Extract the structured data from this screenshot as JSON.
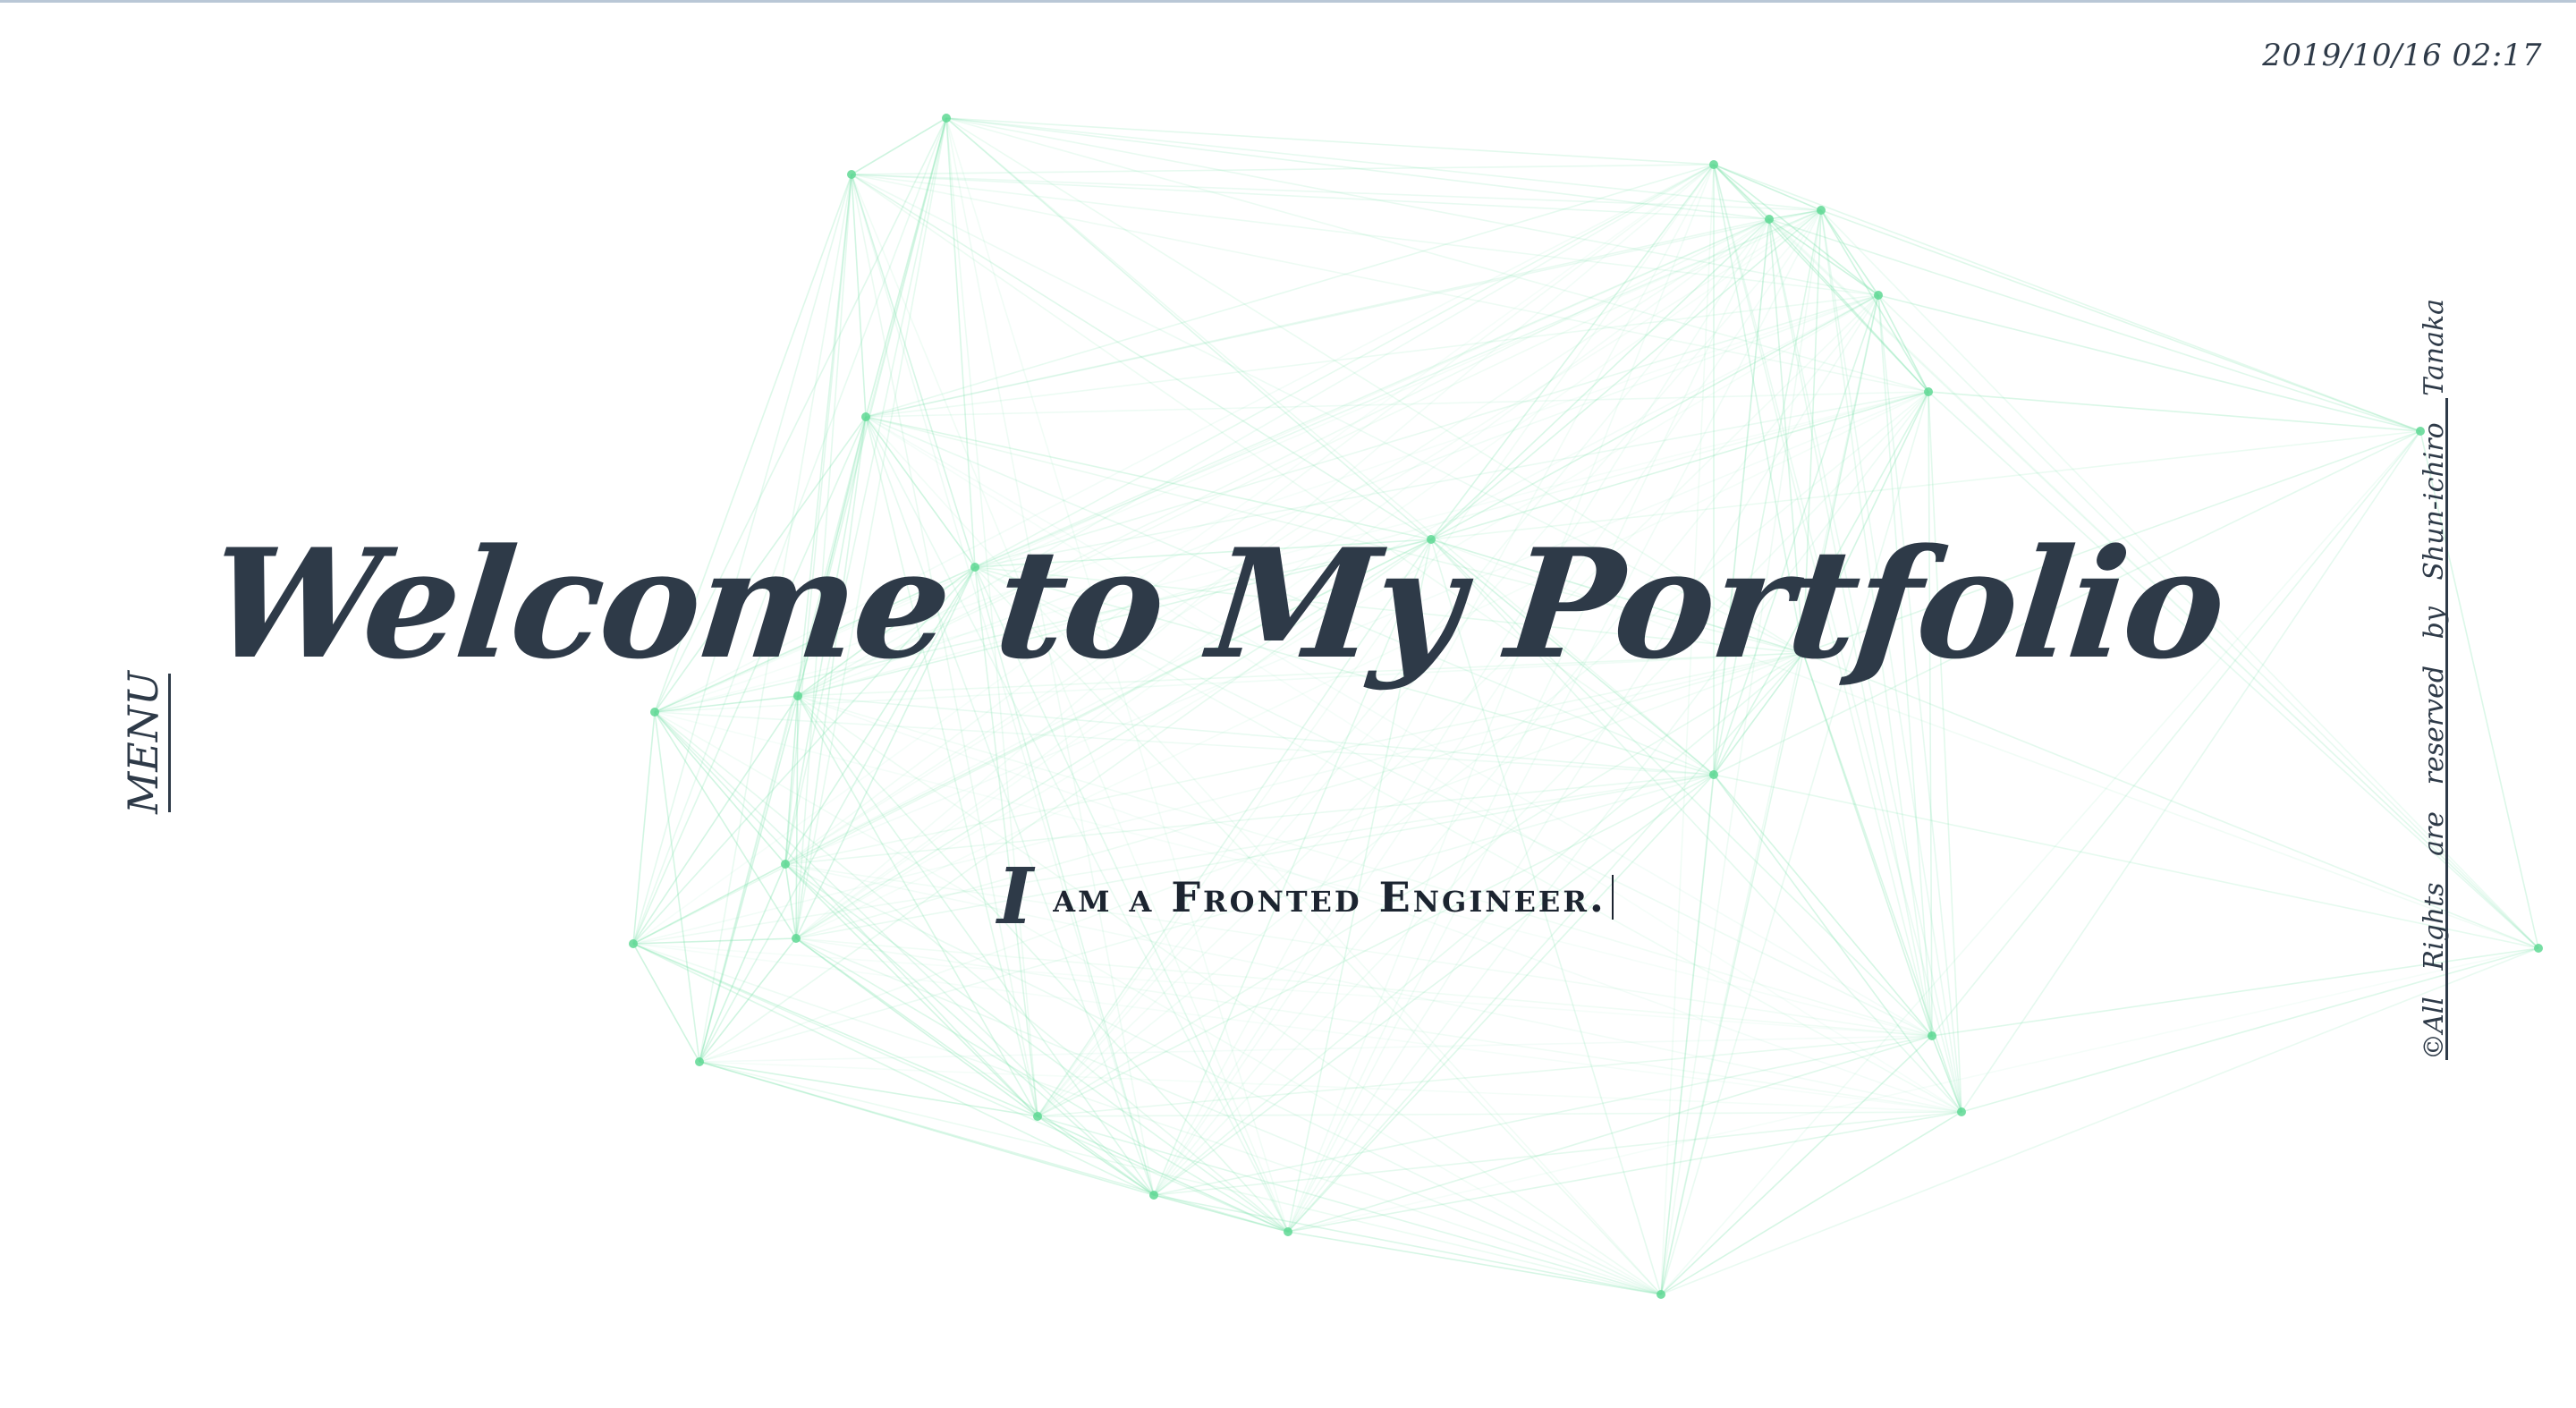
{
  "datetime": "2019/10/16 02:17",
  "menu": {
    "label": "MENU"
  },
  "copyright": "©All Rights are reserved by Shun-ichiro Tanaka",
  "hero": {
    "title": "Welcome to My Portfolio",
    "subtitle_initial": "I",
    "subtitle_rest": "am a Fronted Engineer."
  },
  "colors": {
    "text": "#2e3a48",
    "network_line": "#7fe3ad",
    "network_node": "#5fd894",
    "background": "#ffffff"
  }
}
